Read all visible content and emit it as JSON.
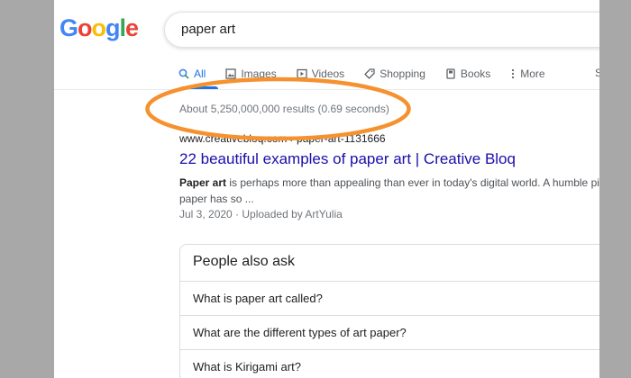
{
  "logo": {
    "letters": [
      {
        "char": "G",
        "color": "#4285F4"
      },
      {
        "char": "o",
        "color": "#EA4335"
      },
      {
        "char": "o",
        "color": "#FBBC05"
      },
      {
        "char": "g",
        "color": "#4285F4"
      },
      {
        "char": "l",
        "color": "#34A853"
      },
      {
        "char": "e",
        "color": "#EA4335"
      }
    ]
  },
  "search": {
    "query": "paper art"
  },
  "tabs": [
    {
      "label": "All",
      "icon": "search-icon",
      "active": true
    },
    {
      "label": "Images",
      "icon": "image-icon",
      "active": false
    },
    {
      "label": "Videos",
      "icon": "play-icon",
      "active": false
    },
    {
      "label": "Shopping",
      "icon": "tag-icon",
      "active": false
    },
    {
      "label": "Books",
      "icon": "book-icon",
      "active": false
    },
    {
      "label": "More",
      "icon": "more-vert-icon",
      "active": false
    }
  ],
  "tab_cut_label": "S",
  "result_stats": "About 5,250,000,000 results (0.69 seconds)",
  "result": {
    "url": "www.creativebloq.com › paper-art-1131666",
    "title": "22 beautiful examples of paper art | Creative Bloq",
    "snippet_bold": "Paper art",
    "snippet_rest": " is perhaps more than appealing than ever in today's digital world. A humble piece of",
    "snippet_line2": "paper has so ...",
    "meta": "Jul 3, 2020 · Uploaded by ArtYulia"
  },
  "people_also_ask": {
    "title": "People also ask",
    "questions": [
      "What is paper art called?",
      "What are the different types of art paper?",
      "What is Kirigami art?"
    ]
  },
  "colors": {
    "annotation": "#F5922F",
    "accent": "#1a73e8",
    "link": "#1a0dab"
  }
}
